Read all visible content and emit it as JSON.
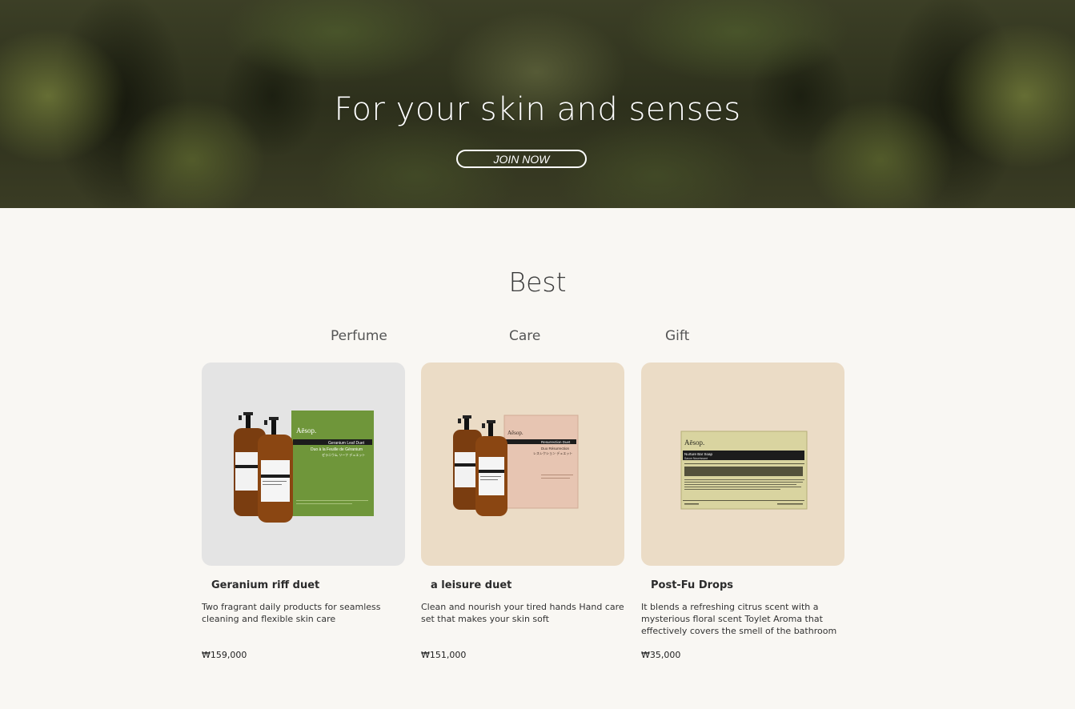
{
  "hero": {
    "title": "For your skin and senses",
    "button_label": "JOIN NOW"
  },
  "best": {
    "title": "Best",
    "tabs": [
      {
        "label": "Perfume"
      },
      {
        "label": "Care"
      },
      {
        "label": "Gift"
      }
    ],
    "products": [
      {
        "name": "Geranium riff duet",
        "description": "Two fragrant daily products for seamless cleaning and flexible skin care",
        "price": "₩159,000",
        "image": {
          "background": "#e4e4e4",
          "box_color": "#6f963a",
          "brand": "Aēsop.",
          "box_label": "Geranium Leaf Duet",
          "box_subtitle": "Duo à la Feuille de Géranium",
          "box_subtitle_ja": "ゼラニウム リーフ デュエット"
        }
      },
      {
        "name": "a leisure duet",
        "description": "Clean and nourish your tired hands Hand care set that makes your skin soft",
        "price": "₩151,000",
        "image": {
          "background": "#ebdcc6",
          "box_color": "#e7c5b2",
          "brand": "Aēsop.",
          "box_label": "Resurrection Duet",
          "box_subtitle": "Duo Résurrection",
          "box_subtitle_ja": "レスレクション デュエット"
        }
      },
      {
        "name": "Post-Fu Drops",
        "description": "It blends a refreshing citrus scent with a mysterious floral scent Toylet Aroma that effectively covers the smell of the bathroom",
        "price": "₩35,000",
        "image": {
          "background": "#ebdcc6",
          "box_color": "#d9d4a0",
          "brand": "Aēsop.",
          "box_label": "Nurture Bar Soap",
          "box_subtitle": "Savon Nourrissant",
          "box_subtitle_ja": ""
        }
      }
    ]
  }
}
